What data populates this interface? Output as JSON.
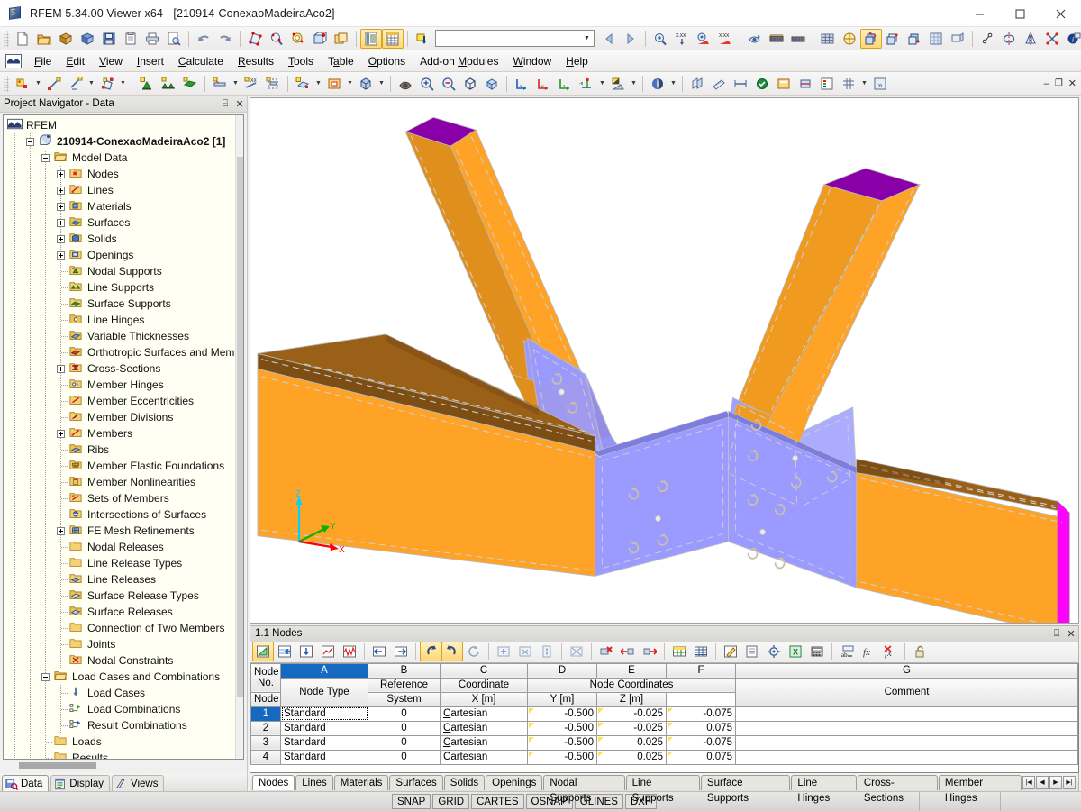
{
  "window": {
    "title": "RFEM 5.34.00 Viewer x64 - [210914-ConexaoMadeiraAco2]",
    "app_icon": "rfem-cube-icon",
    "minimize": "–",
    "maximize": "▫",
    "close": "✕"
  },
  "menubar": {
    "logo": "rfem-logo-icon",
    "items": [
      {
        "label": "File",
        "accel": "F"
      },
      {
        "label": "Edit",
        "accel": "E"
      },
      {
        "label": "View",
        "accel": "V"
      },
      {
        "label": "Insert",
        "accel": "I"
      },
      {
        "label": "Calculate",
        "accel": "C"
      },
      {
        "label": "Results",
        "accel": "R"
      },
      {
        "label": "Tools",
        "accel": "T"
      },
      {
        "label": "Table",
        "accel": "a"
      },
      {
        "label": "Options",
        "accel": "O"
      },
      {
        "label": "Add-on Modules",
        "accel": "M"
      },
      {
        "label": "Window",
        "accel": "W"
      },
      {
        "label": "Help",
        "accel": "H"
      }
    ]
  },
  "toolbar_main": {
    "buttons": [
      "new-file-icon",
      "open-file-icon",
      "open-package-icon",
      "save-package-icon",
      "save-icon",
      "copy-icon",
      "print-icon",
      "print-preview-icon",
      "undo-icon",
      "redo-icon",
      "select-by-rectangle-icon",
      "zoom-select-icon",
      "zoom-circle-icon",
      "select-special-icon",
      "new-window-icon",
      "display-navigator-icon",
      "table-view-icon",
      "load-case-insert-icon"
    ],
    "load_case_combo": {
      "value": "",
      "placeholder": "",
      "dropdown_icon": "chevron-down-icon"
    },
    "nav_prev": "prev-icon",
    "nav_next": "next-icon",
    "result_buttons": [
      "results-on-icon",
      "value-x-xx-icon",
      "results-surfaces-icon",
      "value-label-icon"
    ],
    "tail_buttons": [
      "printout-report-icon",
      "calculate-icon",
      "calculate-all-icon",
      "render-icon",
      "wireframe-icon",
      "solid-model-icon",
      "transparent-icon",
      "mesh-icon",
      "numbering-icon",
      "snap-icon",
      "rotate-icon",
      "mirror-icon",
      "cross-icon",
      "info-icon",
      "clipboard-icon",
      "screenshot-icon"
    ]
  },
  "toolbar_insert": {
    "buttons": [
      "new-node-icon",
      "new-line-icon",
      "new-dim-line-icon",
      "new-polyline-icon",
      "nodal-support-icon",
      "line-support-icon",
      "surface-support-icon",
      "member-icon",
      "member-xx-icon",
      "member-set-icon",
      "new-surface-icon",
      "new-opening-icon",
      "new-solid-icon",
      "view-scene-icon",
      "zoom-in-icon",
      "zoom-out-icon",
      "box-zoom-icon",
      "pan-icon",
      "view-x-icon",
      "view-y-icon",
      "view-z-icon",
      "view-minus-x-icon",
      "shading-icon",
      "render-quality-icon",
      "print-preview-2-icon"
    ]
  },
  "navigator": {
    "caption": "Project Navigator - Data",
    "pin_icon": "pin-icon",
    "close_icon": "close-icon",
    "tree": [
      {
        "label": "RFEM",
        "indent": 0,
        "icon": "rfem-root-icon",
        "expander": "none",
        "bold": false
      },
      {
        "label": "210914-ConexaoMadeiraAco2 [1]",
        "indent": 1,
        "icon": "model-icon",
        "expander": "minus",
        "bold": true
      },
      {
        "label": "Model Data",
        "indent": 2,
        "icon": "folder-open-icon",
        "expander": "minus",
        "bold": false
      },
      {
        "label": "Nodes",
        "indent": 3,
        "icon": "nodes-icon",
        "expander": "plus",
        "bold": false
      },
      {
        "label": "Lines",
        "indent": 3,
        "icon": "lines-icon",
        "expander": "plus",
        "bold": false
      },
      {
        "label": "Materials",
        "indent": 3,
        "icon": "materials-icon",
        "expander": "plus",
        "bold": false
      },
      {
        "label": "Surfaces",
        "indent": 3,
        "icon": "surfaces-icon",
        "expander": "plus",
        "bold": false
      },
      {
        "label": "Solids",
        "indent": 3,
        "icon": "solids-icon",
        "expander": "plus",
        "bold": false
      },
      {
        "label": "Openings",
        "indent": 3,
        "icon": "openings-icon",
        "expander": "plus",
        "bold": false
      },
      {
        "label": "Nodal Supports",
        "indent": 3,
        "icon": "nodal-supports-icon",
        "expander": "none",
        "bold": false
      },
      {
        "label": "Line Supports",
        "indent": 3,
        "icon": "line-supports-icon",
        "expander": "none",
        "bold": false
      },
      {
        "label": "Surface Supports",
        "indent": 3,
        "icon": "surface-supports-icon",
        "expander": "none",
        "bold": false
      },
      {
        "label": "Line Hinges",
        "indent": 3,
        "icon": "line-hinges-icon",
        "expander": "none",
        "bold": false
      },
      {
        "label": "Variable Thicknesses",
        "indent": 3,
        "icon": "variable-thickness-icon",
        "expander": "none",
        "bold": false
      },
      {
        "label": "Orthotropic Surfaces and Memb",
        "indent": 3,
        "icon": "orthotropic-icon",
        "expander": "none",
        "bold": false
      },
      {
        "label": "Cross-Sections",
        "indent": 3,
        "icon": "cross-sections-icon",
        "expander": "plus",
        "bold": false
      },
      {
        "label": "Member Hinges",
        "indent": 3,
        "icon": "member-hinges-icon",
        "expander": "none",
        "bold": false
      },
      {
        "label": "Member Eccentricities",
        "indent": 3,
        "icon": "member-eccentricities-icon",
        "expander": "none",
        "bold": false
      },
      {
        "label": "Member Divisions",
        "indent": 3,
        "icon": "member-divisions-icon",
        "expander": "none",
        "bold": false
      },
      {
        "label": "Members",
        "indent": 3,
        "icon": "members-icon",
        "expander": "plus",
        "bold": false
      },
      {
        "label": "Ribs",
        "indent": 3,
        "icon": "ribs-icon",
        "expander": "none",
        "bold": false
      },
      {
        "label": "Member Elastic Foundations",
        "indent": 3,
        "icon": "member-elastic-foundations-icon",
        "expander": "none",
        "bold": false
      },
      {
        "label": "Member Nonlinearities",
        "indent": 3,
        "icon": "member-nonlinearities-icon",
        "expander": "none",
        "bold": false
      },
      {
        "label": "Sets of Members",
        "indent": 3,
        "icon": "sets-of-members-icon",
        "expander": "none",
        "bold": false
      },
      {
        "label": "Intersections of Surfaces",
        "indent": 3,
        "icon": "intersections-icon",
        "expander": "none",
        "bold": false
      },
      {
        "label": "FE Mesh Refinements",
        "indent": 3,
        "icon": "fe-mesh-refinements-icon",
        "expander": "plus",
        "bold": false
      },
      {
        "label": "Nodal Releases",
        "indent": 3,
        "icon": "folder-icon",
        "expander": "none",
        "bold": false
      },
      {
        "label": "Line Release Types",
        "indent": 3,
        "icon": "folder-icon",
        "expander": "none",
        "bold": false
      },
      {
        "label": "Line Releases",
        "indent": 3,
        "icon": "line-releases-icon",
        "expander": "none",
        "bold": false
      },
      {
        "label": "Surface Release Types",
        "indent": 3,
        "icon": "surface-release-types-icon",
        "expander": "none",
        "bold": false
      },
      {
        "label": "Surface Releases",
        "indent": 3,
        "icon": "surface-releases-icon",
        "expander": "none",
        "bold": false
      },
      {
        "label": "Connection of Two Members",
        "indent": 3,
        "icon": "folder-icon",
        "expander": "none",
        "bold": false
      },
      {
        "label": "Joints",
        "indent": 3,
        "icon": "folder-icon",
        "expander": "none",
        "bold": false
      },
      {
        "label": "Nodal Constraints",
        "indent": 3,
        "icon": "nodal-constraints-icon",
        "expander": "none",
        "bold": false
      },
      {
        "label": "Load Cases and Combinations",
        "indent": 2,
        "icon": "folder-open-icon",
        "expander": "minus",
        "bold": false
      },
      {
        "label": "Load Cases",
        "indent": 3,
        "icon": "load-cases-icon",
        "expander": "none",
        "bold": false
      },
      {
        "label": "Load Combinations",
        "indent": 3,
        "icon": "load-combinations-icon",
        "expander": "none",
        "bold": false
      },
      {
        "label": "Result Combinations",
        "indent": 3,
        "icon": "result-combinations-icon",
        "expander": "none",
        "bold": false
      },
      {
        "label": "Loads",
        "indent": 2,
        "icon": "folder-icon",
        "expander": "none",
        "bold": false
      },
      {
        "label": "Results",
        "indent": 2,
        "icon": "folder-icon",
        "expander": "none",
        "bold": false
      }
    ],
    "tabs": [
      {
        "label": "Data",
        "icon": "data-icon",
        "active": true
      },
      {
        "label": "Display",
        "icon": "display-icon",
        "active": false
      },
      {
        "label": "Views",
        "icon": "views-icon",
        "active": false
      }
    ]
  },
  "viewport": {
    "axis": {
      "x": "X",
      "y": "Y",
      "z": "Z",
      "x_color": "#ff0000",
      "y_color": "#00b400",
      "z_color": "#00d2ff"
    },
    "model_colors": {
      "timber": "#ffa326",
      "timber_shade": "#a06418",
      "steel_plate": "#9a9aff",
      "end_purple": "#8000a0",
      "end_magenta": "#ff00ff",
      "background": "#ffffff",
      "edge": "#b9b9b9"
    }
  },
  "table": {
    "caption": "1.1 Nodes",
    "pin_icon": "pin-icon",
    "close_icon": "close-icon",
    "toolbar": [
      "table-edit-icon",
      "table-insert-row-icon",
      "table-import-icon",
      "table-chart-icon",
      "table-diagram-icon",
      "prev-table-icon",
      "next-table-icon",
      "undo-table-icon",
      "redo-table-icon",
      "refresh-icon",
      "add-row-icon",
      "remove-row-icon",
      "info-row-icon",
      "delete-all-icon",
      "delete-row-icon",
      "insert-left-icon",
      "insert-right-icon",
      "color-table-icon",
      "grid-lines-icon",
      "edit-pen-icon",
      "print-table-icon",
      "settings-icon",
      "excel-icon",
      "calculator-icon",
      "ab-icon",
      "fx-icon",
      "fx-del-icon",
      "lock-icon"
    ],
    "columns": [
      {
        "letter": "A",
        "selected": true
      },
      {
        "letter": "B",
        "selected": false
      },
      {
        "letter": "C",
        "selected": false
      },
      {
        "letter": "D",
        "selected": false
      },
      {
        "letter": "E",
        "selected": false
      },
      {
        "letter": "F",
        "selected": false
      },
      {
        "letter": "G",
        "selected": false
      }
    ],
    "group_header": "Node Coordinates",
    "headers": {
      "node_no_1": "Node",
      "node_no_2": "No.",
      "node_type": "Node Type",
      "reference_node_1": "Reference",
      "reference_node_2": "Node",
      "coord_system_1": "Coordinate",
      "coord_system_2": "System",
      "x": "X [m]",
      "y": "Y [m]",
      "z": "Z [m]",
      "comment": "Comment"
    },
    "rows": [
      {
        "no": "1",
        "type": "Standard",
        "ref": "0",
        "cs": "Cartesian",
        "x": "-0.500",
        "y": "-0.025",
        "z": "-0.075",
        "comment": "",
        "selected": true
      },
      {
        "no": "2",
        "type": "Standard",
        "ref": "0",
        "cs": "Cartesian",
        "x": "-0.500",
        "y": "-0.025",
        "z": "0.075",
        "comment": "",
        "selected": false
      },
      {
        "no": "3",
        "type": "Standard",
        "ref": "0",
        "cs": "Cartesian",
        "x": "-0.500",
        "y": "0.025",
        "z": "-0.075",
        "comment": "",
        "selected": false
      },
      {
        "no": "4",
        "type": "Standard",
        "ref": "0",
        "cs": "Cartesian",
        "x": "-0.500",
        "y": "0.025",
        "z": "0.075",
        "comment": "",
        "selected": false
      }
    ],
    "tabs": [
      {
        "label": "Nodes",
        "active": true
      },
      {
        "label": "Lines",
        "active": false
      },
      {
        "label": "Materials",
        "active": false
      },
      {
        "label": "Surfaces",
        "active": false
      },
      {
        "label": "Solids",
        "active": false
      },
      {
        "label": "Openings",
        "active": false
      },
      {
        "label": "Nodal Supports",
        "active": false
      },
      {
        "label": "Line Supports",
        "active": false
      },
      {
        "label": "Surface Supports",
        "active": false
      },
      {
        "label": "Line Hinges",
        "active": false
      },
      {
        "label": "Cross-Sections",
        "active": false
      },
      {
        "label": "Member Hinges",
        "active": false
      }
    ],
    "nav_buttons": [
      "first-record-icon",
      "prev-record-icon",
      "next-record-icon",
      "last-record-icon"
    ]
  },
  "statusbar": {
    "modes": [
      "SNAP",
      "GRID",
      "CARTES",
      "OSNAP",
      "GLINES",
      "DXF"
    ]
  }
}
